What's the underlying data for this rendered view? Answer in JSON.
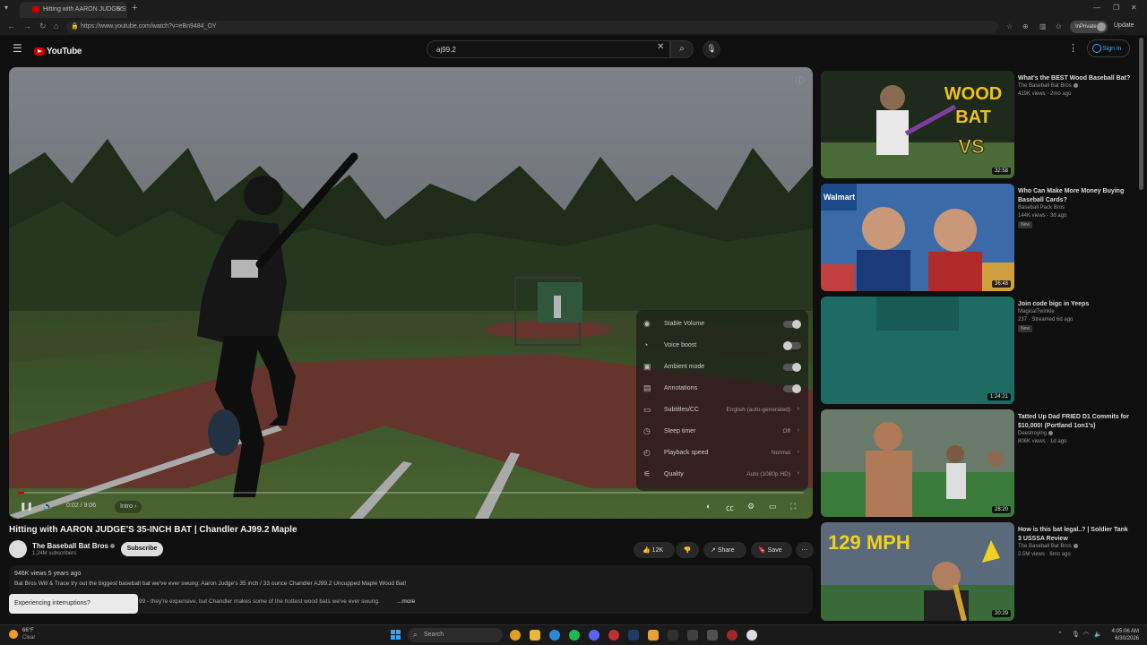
{
  "browser": {
    "tab_title": "Hitting with AARON JUDGE'S",
    "tab_close": "✕",
    "new_tab": "+",
    "url": "https://www.youtube.com/watch?v=eBn9484_OY",
    "profile_label": "InPrivate",
    "update_label": "Update"
  },
  "header": {
    "logo_text": "YouTube",
    "search_value": "aj99.2",
    "signin_label": "Sign in"
  },
  "player": {
    "time_readout": "0:02 / 9:06",
    "chapter": "Intro",
    "progress_fraction": 0.004,
    "settings": [
      {
        "icon": "stable-volume-icon",
        "label": "Stable Volume",
        "type": "toggle",
        "on": true
      },
      {
        "icon": "voice-boost-icon",
        "label": "Voice boost",
        "type": "toggle",
        "on": false
      },
      {
        "icon": "ambient-mode-icon",
        "label": "Ambient mode",
        "type": "toggle",
        "on": true
      },
      {
        "icon": "annotations-icon",
        "label": "Annotations",
        "type": "toggle",
        "on": true
      },
      {
        "icon": "subtitles-icon",
        "label": "Subtitles/CC",
        "type": "value",
        "value": "English (auto-generated)"
      },
      {
        "icon": "sleep-timer-icon",
        "label": "Sleep timer",
        "type": "value",
        "value": "Off"
      },
      {
        "icon": "playback-speed-icon",
        "label": "Playback speed",
        "type": "value",
        "value": "Normal"
      },
      {
        "icon": "quality-icon",
        "label": "Quality",
        "type": "value",
        "value": "Auto (1080p HD)"
      }
    ]
  },
  "video": {
    "title": "Hitting with AARON JUDGE'S 35-INCH BAT | Chandler AJ99.2 Maple",
    "channel": "The Baseball Bat Bros",
    "subscribers": "1.24M subscribers",
    "subscribe_label": "Subscribe",
    "likes": "12K",
    "share_label": "Share",
    "save_label": "Save",
    "desc_meta": "946K views  5 years ago",
    "desc_line1": "Bat Bros Will & Trace try out the biggest baseball bat we've ever swung: Aaron Judge's 35 inch / 33 ounce Chandler AJ99.2 Uncupped Maple Wood Bat!",
    "desc_line2": "99 - they're expensive, but Chandler makes some of the hottest wood bats we've ever swung.",
    "desc_more": "...more",
    "interruption_prompt": "Experiencing interruptions?"
  },
  "recommendations": [
    {
      "title": "What's the BEST Wood Baseball Bat?",
      "channel": "The Baseball Bat Bros",
      "verified": true,
      "meta": "419K views · 2mo ago",
      "duration": "32:58",
      "badge": ""
    },
    {
      "title": "Who Can Make More Money Buying Baseball Cards?",
      "channel": "Baseball Pack Bros",
      "verified": false,
      "meta": "144K views · 3d ago",
      "duration": "36:48",
      "badge": "New"
    },
    {
      "title": "Join code bigc in Yeeps",
      "channel": "MagicalTwinkle",
      "verified": false,
      "meta": "237 · Streamed 6d ago",
      "duration": "1:24:21",
      "badge": "New"
    },
    {
      "title": "Tatted Up Dad FRIED D1 Commits for $10,000! (Portland 1on1's)",
      "channel": "Deestroying",
      "verified": true,
      "meta": "806K views · 1d ago",
      "duration": "28:20",
      "badge": ""
    },
    {
      "title": "How is this bat legal..? | Soldier Tank 3 USSSA Review",
      "channel": "The Baseball Bat Bros",
      "verified": true,
      "meta": "2.5M views · 6mo ago",
      "duration": "20:29",
      "badge": ""
    }
  ],
  "thumb_text": {
    "wood": "WOOD",
    "bat": "BAT",
    "vs": "VS",
    "walmart": "Walmart",
    "mph": "129 MPH"
  },
  "taskbar": {
    "temp": "66°F",
    "condition": "Clear",
    "search_placeholder": "Search",
    "time": "4:05:06 AM",
    "date": "6/30/2026"
  },
  "colors": {
    "yt_red": "#cc0000",
    "link_blue": "#3ea6ff"
  }
}
